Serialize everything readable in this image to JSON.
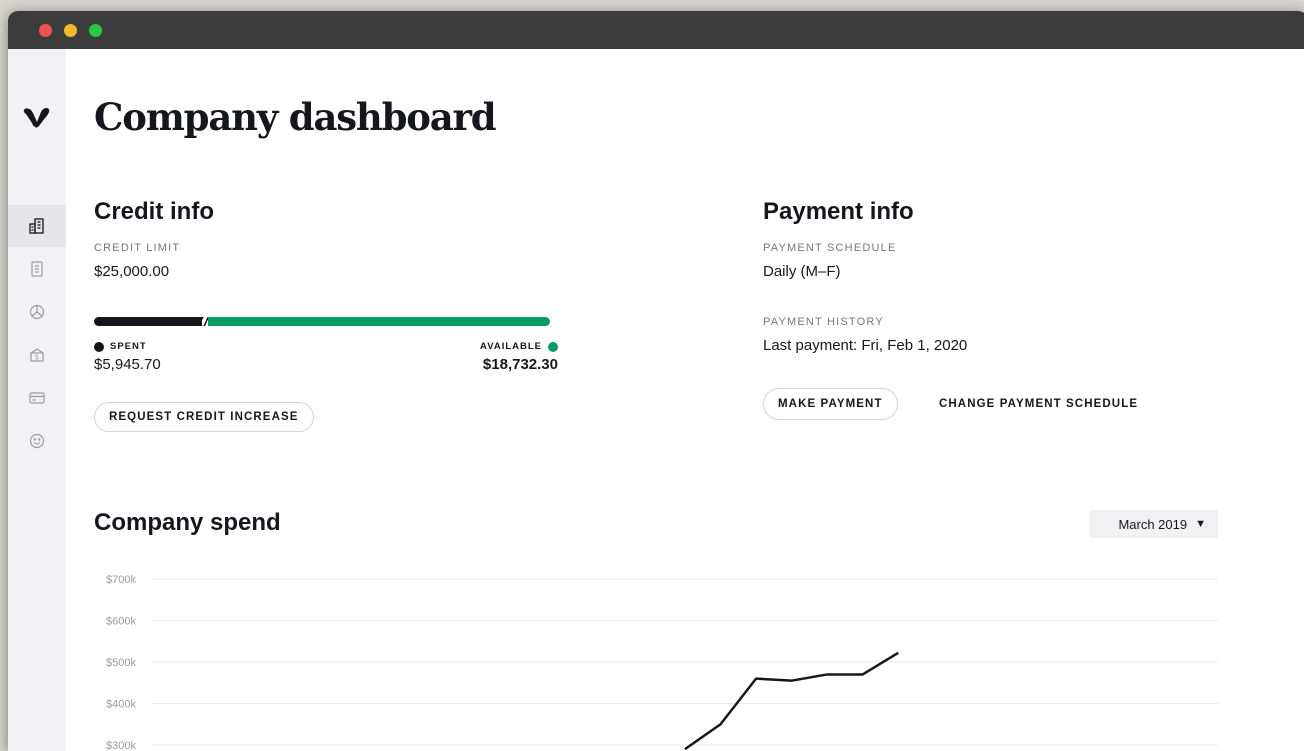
{
  "app": {
    "page_title": "Company dashboard"
  },
  "sidebar": {
    "items": [
      {
        "icon": "buildings-icon",
        "active": true
      },
      {
        "icon": "receipt-icon",
        "active": false
      },
      {
        "icon": "pie-chart-icon",
        "active": false
      },
      {
        "icon": "invoice-icon",
        "active": false
      },
      {
        "icon": "card-icon",
        "active": false
      },
      {
        "icon": "smiley-icon",
        "active": false
      }
    ]
  },
  "credit": {
    "title": "Credit info",
    "limit_label": "CREDIT LIMIT",
    "limit_value": "$25,000.00",
    "spent_label": "SPENT",
    "spent_value": "$5,945.70",
    "available_label": "AVAILABLE",
    "available_value": "$18,732.30",
    "spent_fraction": 0.2378,
    "available_fraction": 0.7493,
    "request_button": "REQUEST CREDIT INCREASE"
  },
  "payment": {
    "title": "Payment info",
    "schedule_label": "PAYMENT SCHEDULE",
    "schedule_value": "Daily (M–F)",
    "history_label": "PAYMENT HISTORY",
    "history_value": "Last payment: Fri, Feb 1, 2020",
    "make_payment_button": "MAKE PAYMENT",
    "change_schedule_button": "CHANGE PAYMENT SCHEDULE"
  },
  "spend": {
    "title": "Company spend",
    "month_select": "March 2019",
    "dropdown_arrow": "▼"
  },
  "colors": {
    "spent": "#16161d",
    "available": "#0a9b65",
    "sidebar_bg": "#f2f2f4"
  },
  "chart_data": {
    "type": "line",
    "ylim": [
      300000,
      700000
    ],
    "y_ticks": [
      "$300k",
      "$400k",
      "$500k",
      "$600k",
      "$700k"
    ],
    "y_tick_values": [
      300000,
      400000,
      500000,
      600000,
      700000
    ],
    "x_total_points": 31,
    "series": [
      {
        "x": [
          16,
          17,
          18,
          19,
          20,
          21,
          22
        ],
        "values": [
          290000,
          350000,
          460000,
          455000,
          470000,
          470000,
          522000
        ]
      }
    ],
    "grid": true
  }
}
